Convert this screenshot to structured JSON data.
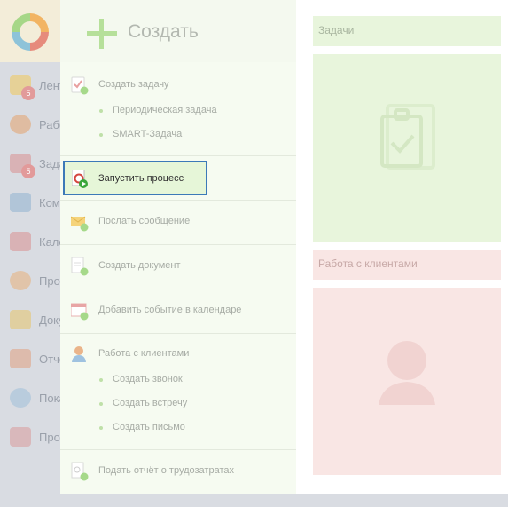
{
  "sidebar": {
    "items": [
      {
        "label": "Лента",
        "icon": "feed-icon",
        "badge": "5"
      },
      {
        "label": "Работа",
        "icon": "employee-icon",
        "badge": ""
      },
      {
        "label": "Задачи",
        "icon": "tasks-icon",
        "badge": "5"
      },
      {
        "label": "Компания",
        "icon": "structure-icon",
        "badge": ""
      },
      {
        "label": "Календарь",
        "icon": "calendar-icon",
        "badge": ""
      },
      {
        "label": "Процессы",
        "icon": "process-icon",
        "badge": ""
      },
      {
        "label": "Документы",
        "icon": "documents-icon",
        "badge": ""
      },
      {
        "label": "Отчеты",
        "icon": "reports-icon",
        "badge": ""
      },
      {
        "label": "Показатели",
        "icon": "gauge-icon",
        "badge": ""
      },
      {
        "label": "Проекты",
        "icon": "projects-icon",
        "badge": ""
      }
    ]
  },
  "menu": {
    "title": "Создать",
    "items": {
      "create_task": "Создать задачу",
      "periodic_task": "Периодическая задача",
      "smart_task": "SMART-Задача",
      "start_process": "Запустить процесс",
      "send_message": "Послать сообщение",
      "create_document": "Создать документ",
      "add_calendar_event": "Добавить событие в календаре",
      "client_work": "Работа с клиентами",
      "create_call": "Создать звонок",
      "create_meeting": "Создать встречу",
      "create_letter": "Создать письмо",
      "submit_timesheet": "Подать отчёт о трудозатратах"
    }
  },
  "widgets": {
    "tasks_title": "Задачи",
    "clients_title": "Работа с клиентами"
  },
  "colors": {
    "highlight_border": "#3c79b8",
    "menu_accent": "#b6e09a",
    "tasks_widget": "#e8f5dc",
    "clients_widget": "#f9e6e4"
  }
}
